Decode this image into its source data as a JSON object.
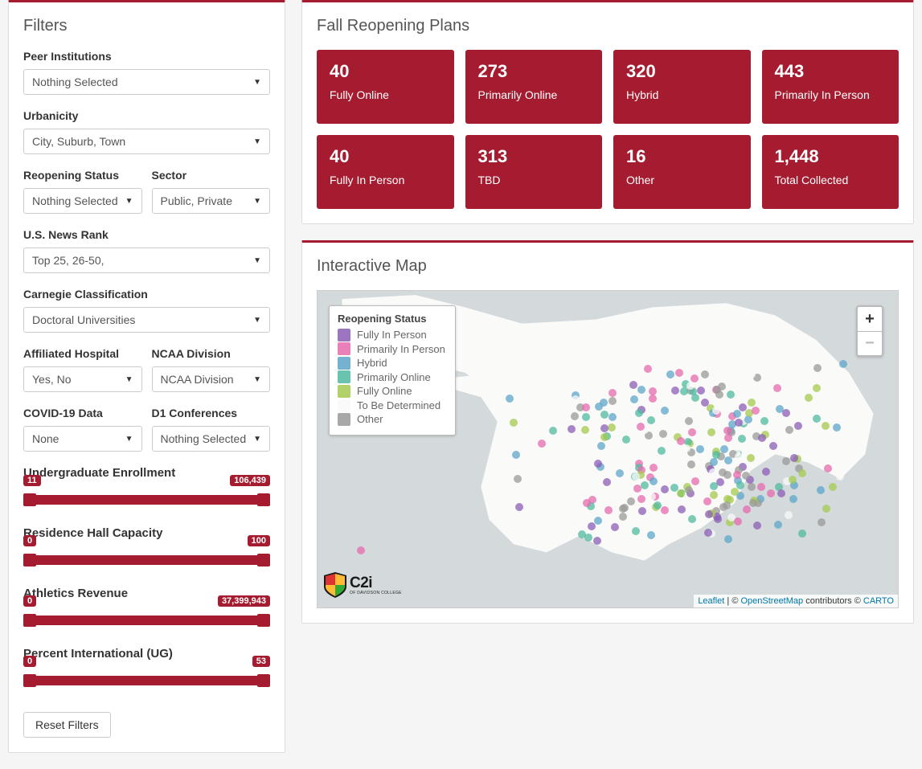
{
  "filters": {
    "title": "Filters",
    "items": [
      {
        "label": "Peer Institutions",
        "value": "Nothing Selected"
      },
      {
        "label": "Urbanicity",
        "value": "City, Suburb, Town"
      },
      {
        "label": "Reopening Status",
        "value": "Nothing Selected"
      },
      {
        "label": "Sector",
        "value": "Public, Private"
      },
      {
        "label": "U.S. News Rank",
        "value": "Top 25, 26-50,"
      },
      {
        "label": "Carnegie Classification",
        "value": "Doctoral Universities"
      },
      {
        "label": "Affiliated Hospital",
        "value": "Yes, No"
      },
      {
        "label": "NCAA Division",
        "value": "NCAA Division"
      },
      {
        "label": "COVID-19 Data",
        "value": "None"
      },
      {
        "label": "D1 Conferences",
        "value": "Nothing Selected"
      }
    ],
    "sliders": [
      {
        "label": "Undergraduate Enrollment",
        "min": "11",
        "max": "106,439"
      },
      {
        "label": "Residence Hall Capacity",
        "min": "0",
        "max": "100"
      },
      {
        "label": "Athletics Revenue",
        "min": "0",
        "max": "37,399,943"
      },
      {
        "label": "Percent International (UG)",
        "min": "0",
        "max": "53"
      }
    ],
    "reset": "Reset Filters"
  },
  "stats": {
    "title": "Fall Reopening Plans",
    "cards": [
      {
        "n": "40",
        "l": "Fully Online"
      },
      {
        "n": "273",
        "l": "Primarily Online"
      },
      {
        "n": "320",
        "l": "Hybrid"
      },
      {
        "n": "443",
        "l": "Primarily In Person"
      },
      {
        "n": "40",
        "l": "Fully In Person"
      },
      {
        "n": "313",
        "l": "TBD"
      },
      {
        "n": "16",
        "l": "Other"
      },
      {
        "n": "1,448",
        "l": "Total Collected"
      }
    ]
  },
  "map": {
    "title": "Interactive Map",
    "legend_title": "Reopening Status",
    "legend_items": [
      {
        "color": "#8b5db5",
        "label": "Fully In Person"
      },
      {
        "color": "#e66aae",
        "label": "Primarily In Person"
      },
      {
        "color": "#5da5c9",
        "label": "Hybrid"
      },
      {
        "color": "#4fb9a0",
        "label": "Primarily Online"
      },
      {
        "color": "#a4c94f",
        "label": "Fully Online"
      },
      {
        "color": "#f9f9f9",
        "label": "To Be Determined"
      },
      {
        "color": "#999999",
        "label": "Other"
      }
    ],
    "attrib": {
      "leaflet": "Leaflet",
      "sep1": " | © ",
      "osm": "OpenStreetMap",
      "sep2": " contributors © ",
      "carto": "CARTO"
    },
    "logo_text": "C2i",
    "logo_sub": "OF DAVIDSON COLLEGE"
  }
}
